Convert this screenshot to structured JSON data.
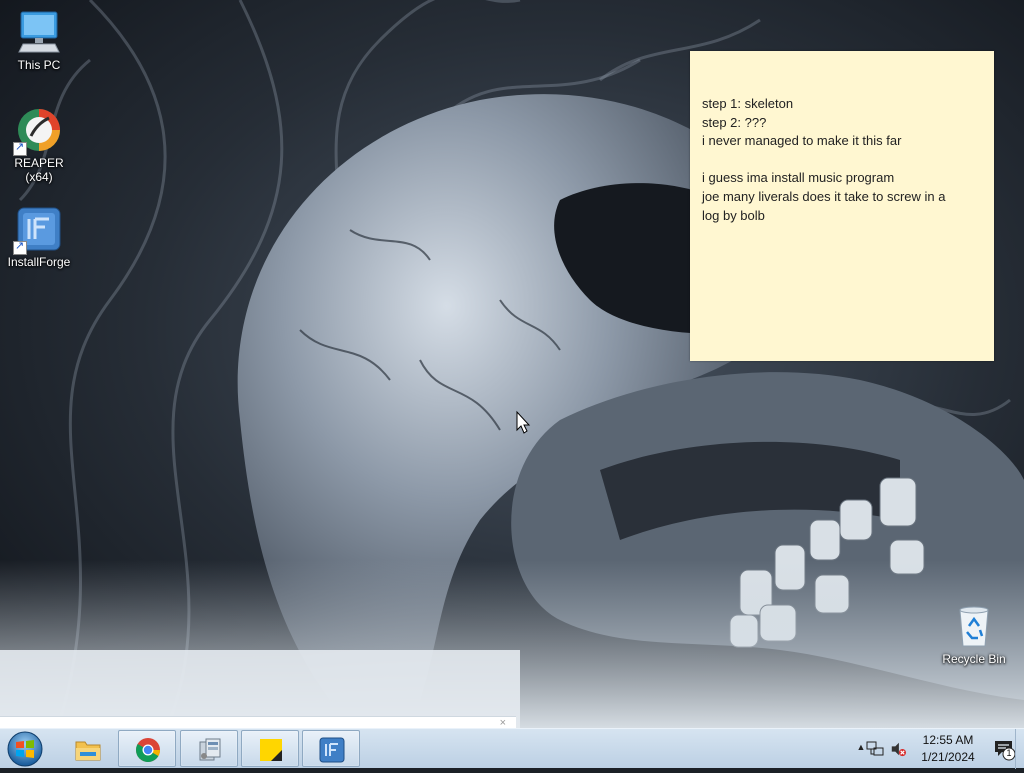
{
  "desktop": {
    "icons": [
      {
        "label": "This PC"
      },
      {
        "label": "REAPER (x64)"
      },
      {
        "label": "InstallForge"
      },
      {
        "label": "Recycle Bin"
      }
    ]
  },
  "sticky_note": {
    "lines": [
      "step 1: skeleton",
      "step 2: ???",
      "i never managed to make it this far",
      "",
      "i guess ima install music program",
      "joe many liverals does it take to screw in a",
      "log by bolb"
    ],
    "background": "#fff7d1"
  },
  "hidden_window": {
    "close_glyph": "×"
  },
  "taskbar": {
    "buttons": [
      {
        "name": "file-explorer",
        "icon": "folder-icon"
      },
      {
        "name": "google-chrome",
        "icon": "chrome-icon"
      },
      {
        "name": "system-config",
        "icon": "control-panel-icon"
      },
      {
        "name": "sticky-notes",
        "icon": "sticky-notes-icon"
      },
      {
        "name": "installforge",
        "icon": "installforge-icon"
      }
    ],
    "tray": {
      "chevron": "▲",
      "time": "12:55 AM",
      "date": "1/21/2024",
      "notification_count": "1"
    }
  }
}
